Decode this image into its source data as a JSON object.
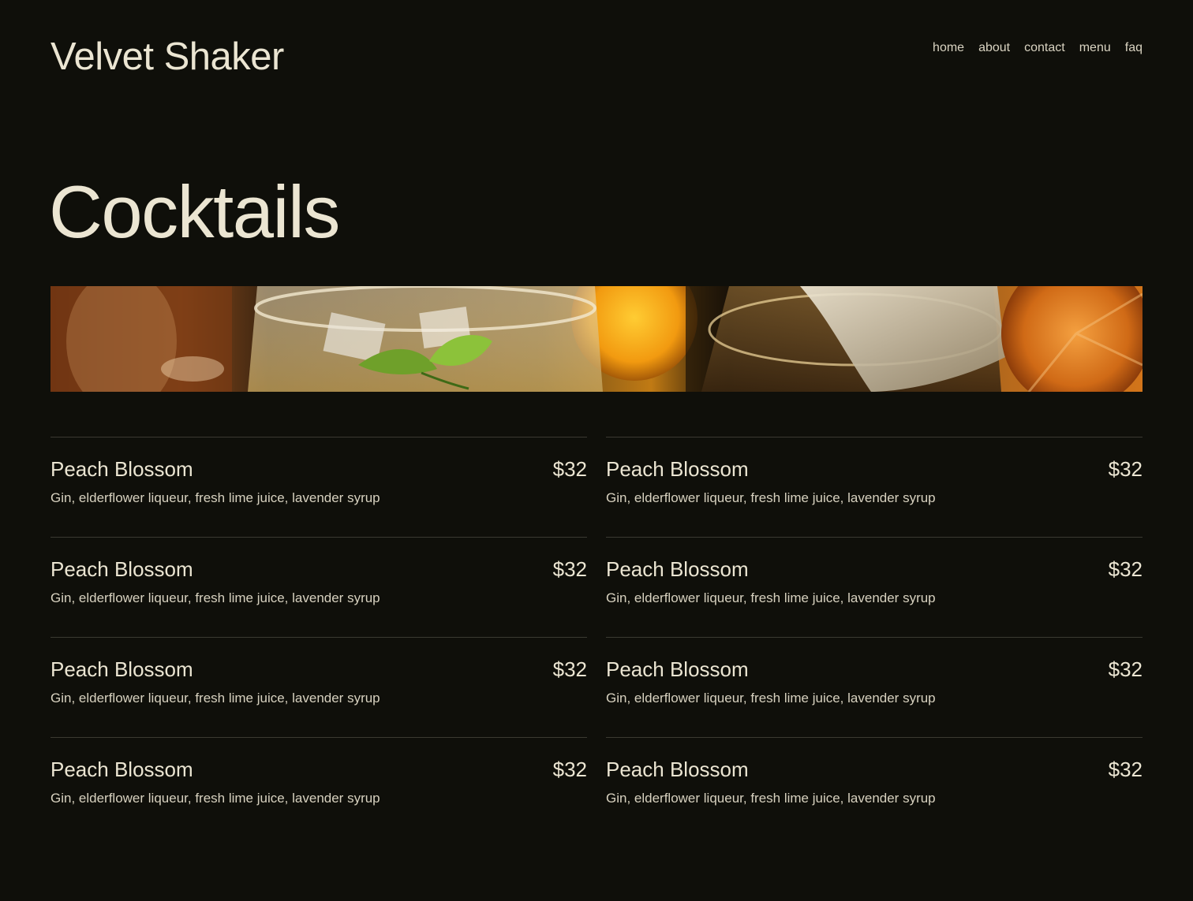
{
  "header": {
    "brand": "Velvet Shaker",
    "nav": [
      {
        "label": "home"
      },
      {
        "label": "about"
      },
      {
        "label": "contact"
      },
      {
        "label": "menu"
      },
      {
        "label": "faq"
      }
    ]
  },
  "page": {
    "title": "Cocktails"
  },
  "colors": {
    "background": "#0f0f0a",
    "text": "#ebe5d2",
    "divider": "#3b3a32"
  },
  "menu": {
    "items": [
      {
        "name": "Peach Blossom",
        "price": "$32",
        "description": "Gin, elderflower liqueur, fresh lime juice, lavender syrup"
      },
      {
        "name": "Peach Blossom",
        "price": "$32",
        "description": "Gin, elderflower liqueur, fresh lime juice, lavender syrup"
      },
      {
        "name": "Peach Blossom",
        "price": "$32",
        "description": "Gin, elderflower liqueur, fresh lime juice, lavender syrup"
      },
      {
        "name": "Peach Blossom",
        "price": "$32",
        "description": "Gin, elderflower liqueur, fresh lime juice, lavender syrup"
      },
      {
        "name": "Peach Blossom",
        "price": "$32",
        "description": "Gin, elderflower liqueur, fresh lime juice, lavender syrup"
      },
      {
        "name": "Peach Blossom",
        "price": "$32",
        "description": "Gin, elderflower liqueur, fresh lime juice, lavender syrup"
      },
      {
        "name": "Peach Blossom",
        "price": "$32",
        "description": "Gin, elderflower liqueur, fresh lime juice, lavender syrup"
      },
      {
        "name": "Peach Blossom",
        "price": "$32",
        "description": "Gin, elderflower liqueur, fresh lime juice, lavender syrup"
      }
    ]
  }
}
